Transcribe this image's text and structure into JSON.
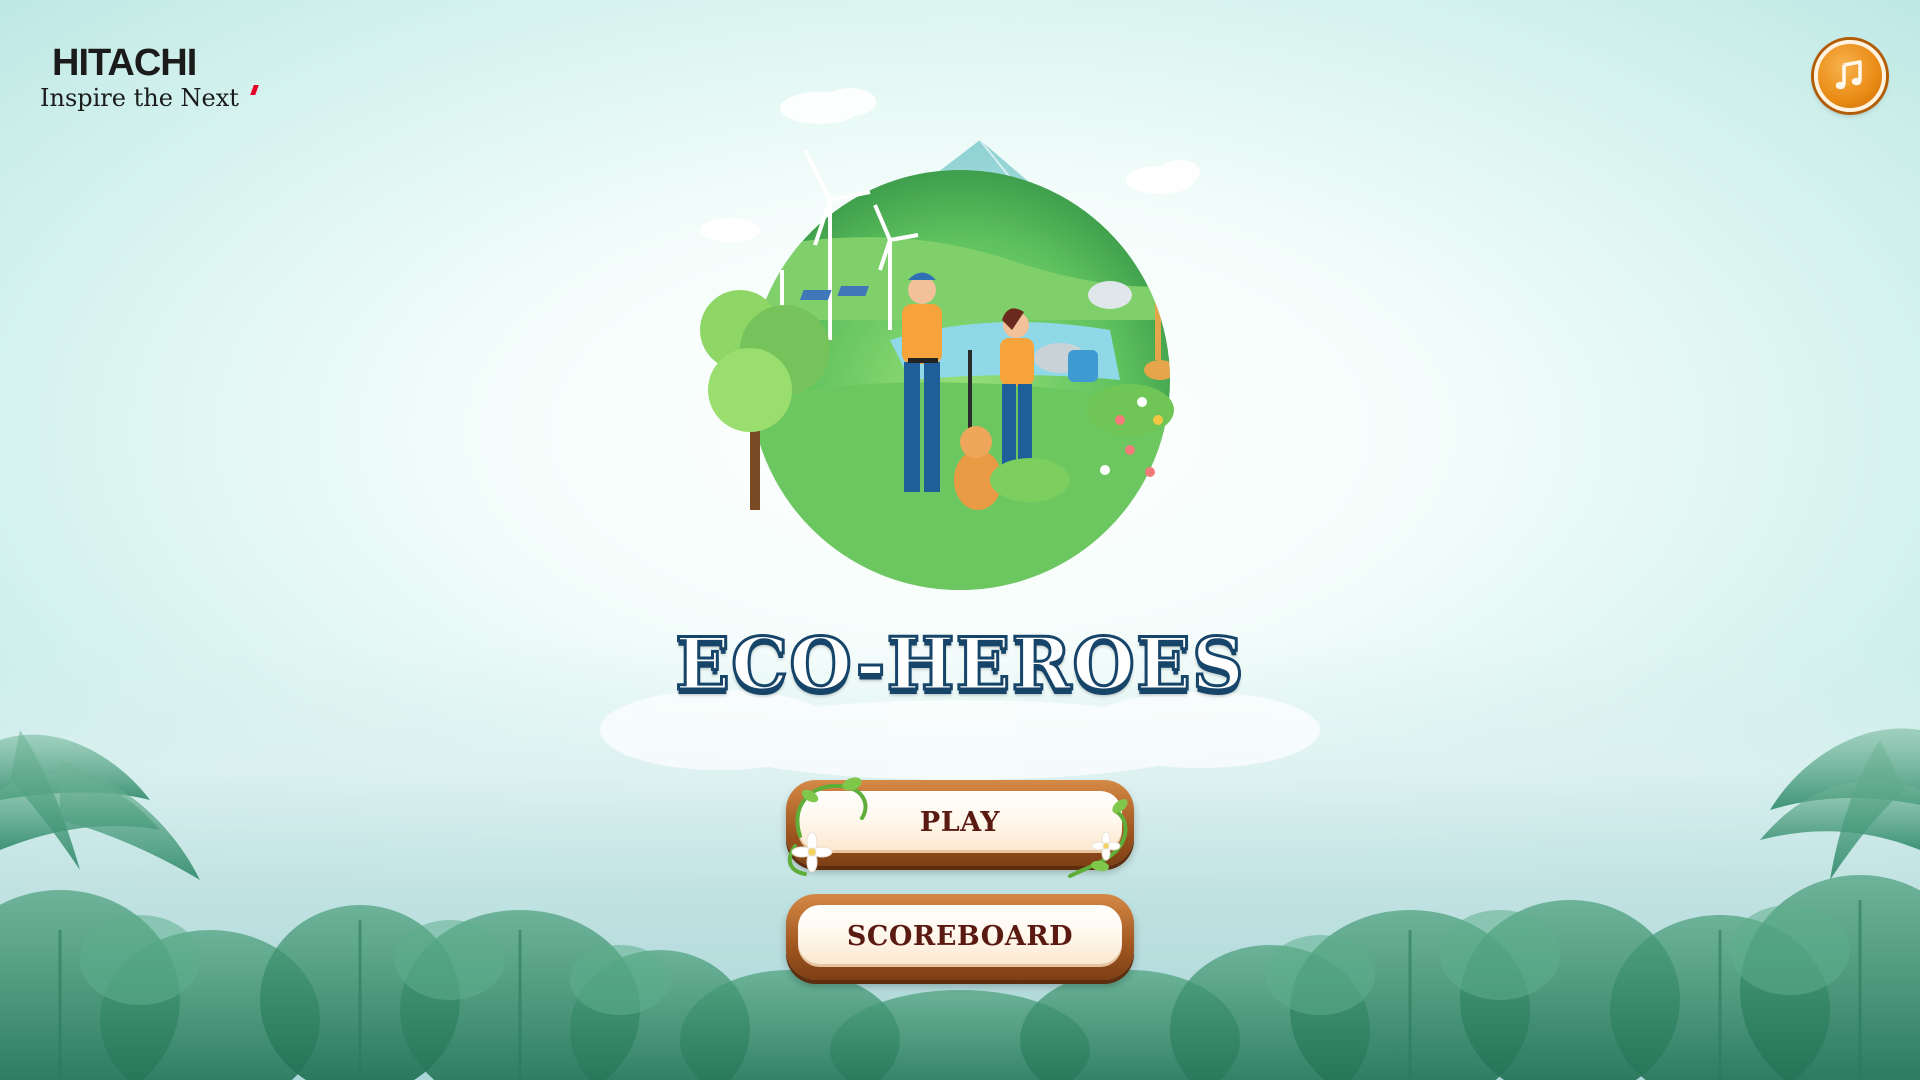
{
  "logo": {
    "brand": "HITACHI",
    "tagline": "Inspire the Next"
  },
  "header": {
    "music_icon": "music-note-icon"
  },
  "title": "ECO-HEROES",
  "menu": {
    "play_label": "PLAY",
    "scoreboard_label": "SCOREBOARD"
  },
  "colors": {
    "title_outline": "#17456a",
    "button_text": "#5a1a12",
    "wood": "#a45a22",
    "music_button": "#e98b14"
  }
}
